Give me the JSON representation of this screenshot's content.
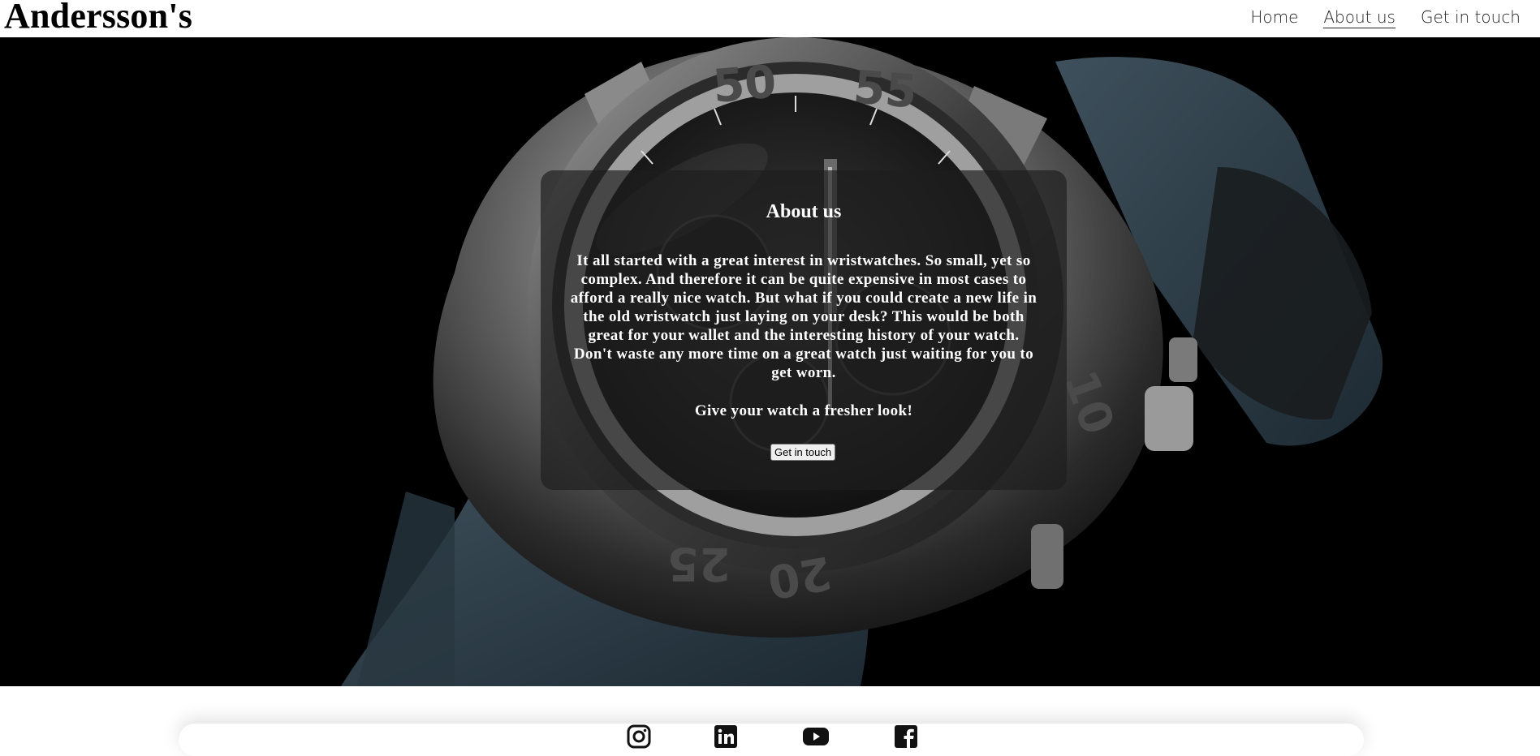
{
  "header": {
    "brand": "Andersson's",
    "nav": [
      {
        "label": "Home",
        "active": false
      },
      {
        "label": "About us",
        "active": true
      },
      {
        "label": "Get in touch",
        "active": false
      }
    ]
  },
  "about": {
    "title": "About us",
    "body": "It all started with a great interest in wristwatches. So small, yet so complex. And therefore it can be quite expensive in most cases to afford a really nice watch. But what if you could create a new life in the old wristwatch just laying on your desk? This would be both great for your wallet and the interesting history of your watch. Don't waste any more time on a great watch just waiting for you to get worn.",
    "tagline": "Give your watch a fresher look!",
    "button": "Get in touch"
  },
  "footer": {
    "social_icons": [
      "instagram-icon",
      "linkedin-icon",
      "youtube-icon",
      "facebook-icon"
    ]
  },
  "colors": {
    "hero_background": "#000000",
    "panel": "#1e1e1e",
    "strap": "#2f3f4a"
  }
}
